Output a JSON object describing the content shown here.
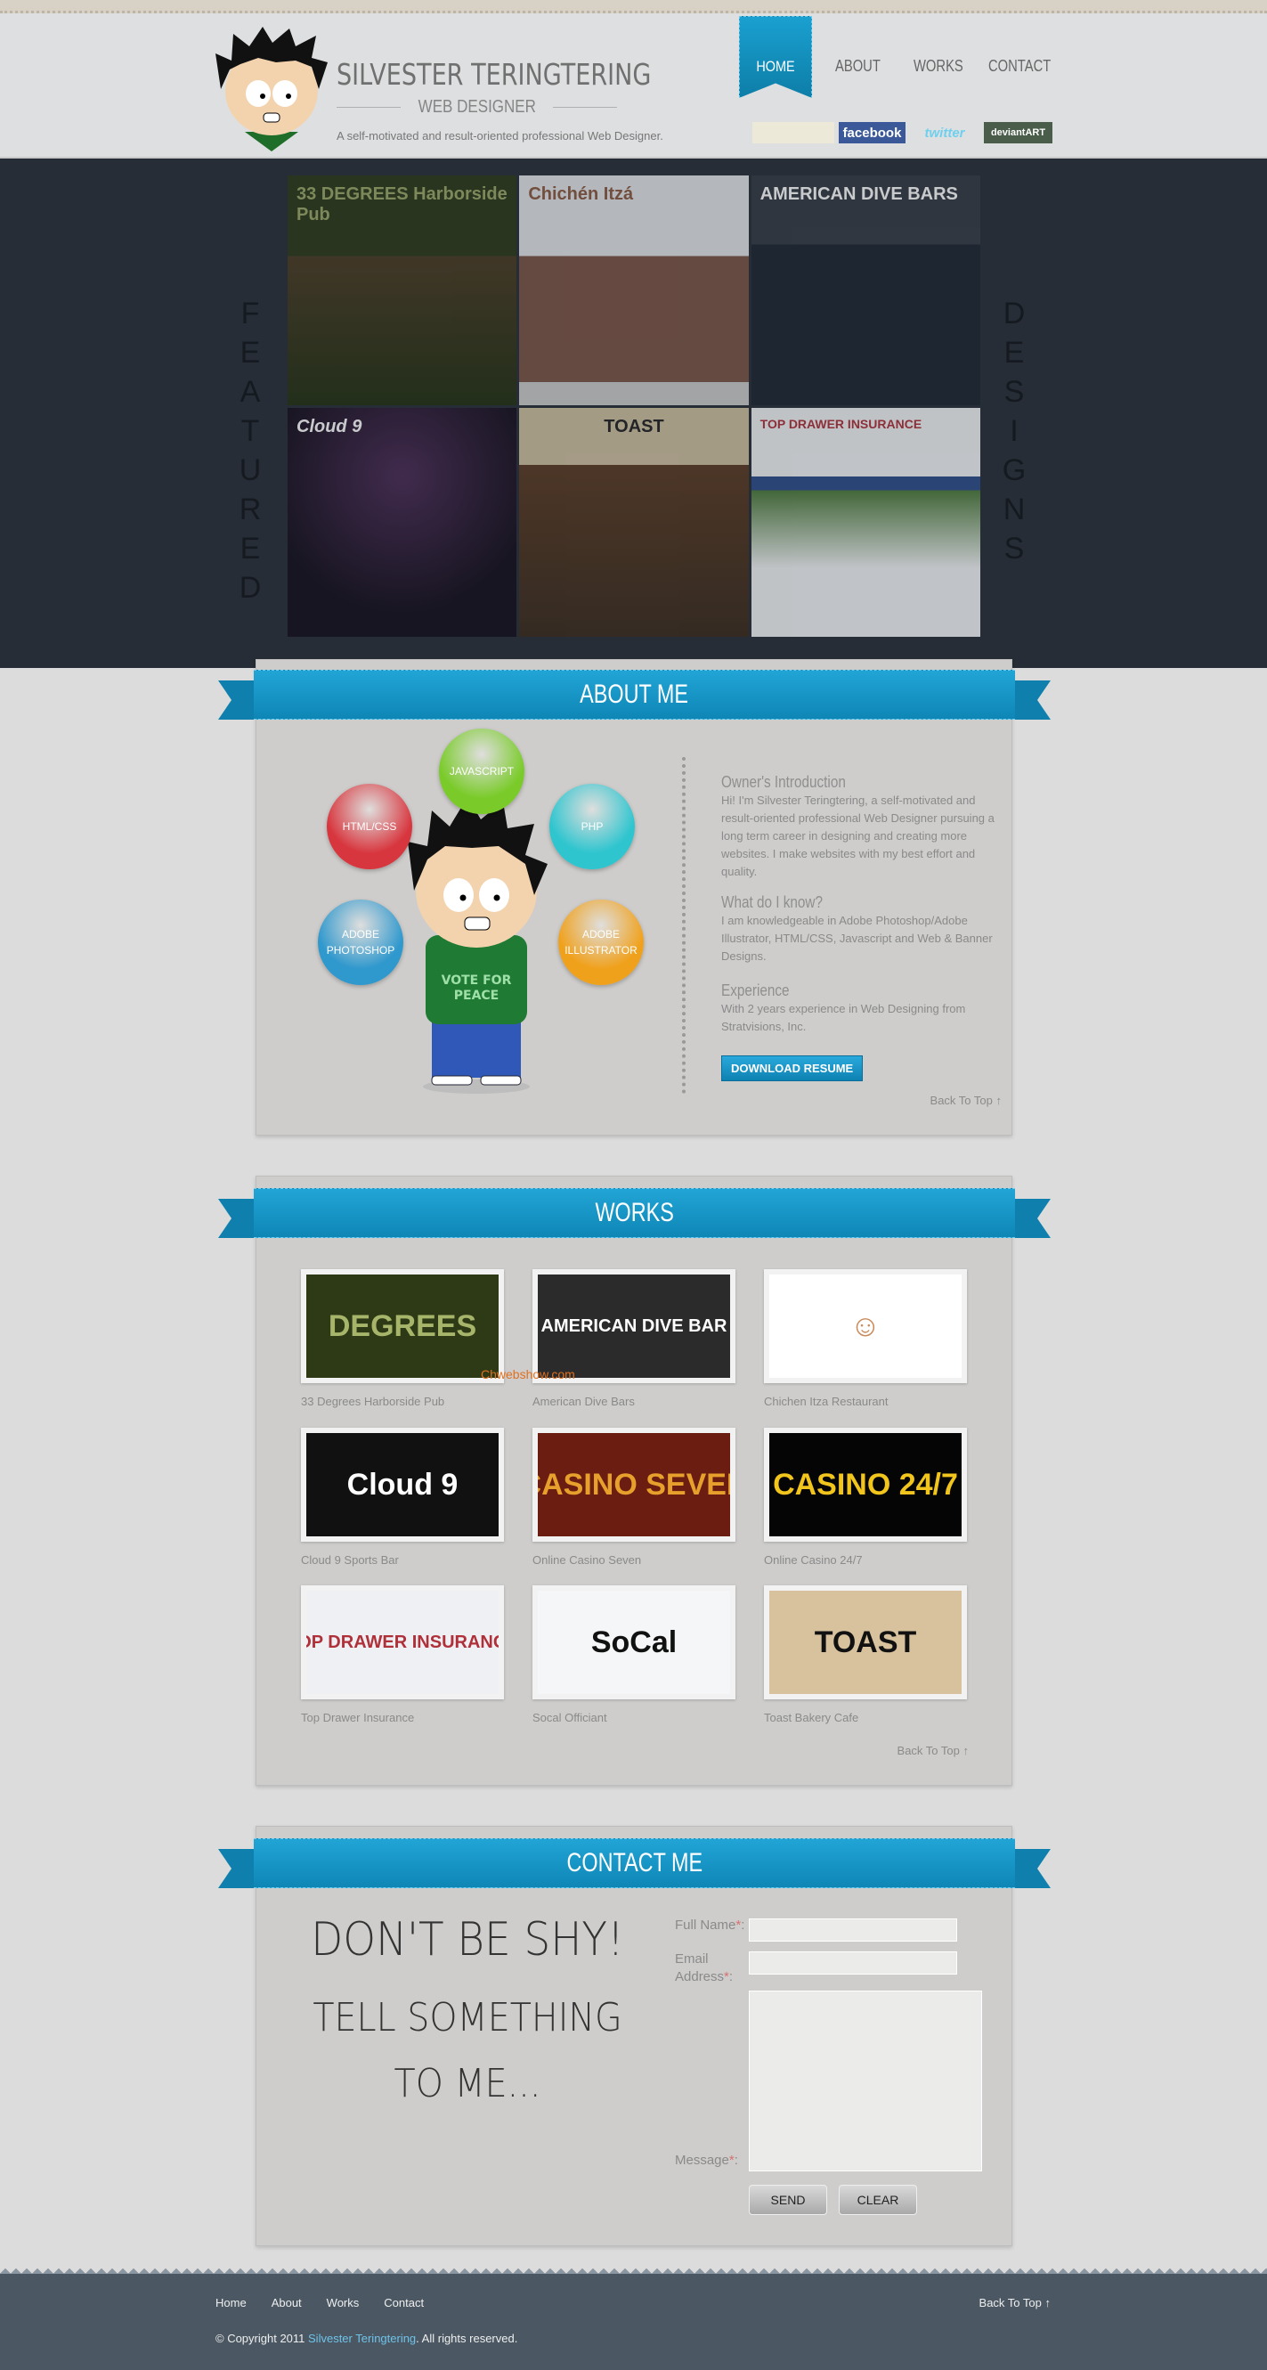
{
  "header": {
    "title": "SILVESTER TERINGTERING",
    "subtitle": "WEB DESIGNER",
    "tagline": "A self-motivated and result-oriented professional Web Designer.",
    "nav": [
      {
        "label": "HOME",
        "active": true
      },
      {
        "label": "ABOUT"
      },
      {
        "label": "WORKS"
      },
      {
        "label": "CONTACT"
      }
    ],
    "social": [
      {
        "label": "facebook",
        "icon": "facebook-icon"
      },
      {
        "label": "twitter",
        "icon": "twitter-icon"
      },
      {
        "label": "deviantART",
        "icon": "deviantart-icon"
      }
    ],
    "search": {
      "value": "",
      "placeholder": ""
    }
  },
  "featured": {
    "left": [
      "F",
      "E",
      "A",
      "T",
      "U",
      "R",
      "E",
      "D"
    ],
    "right": [
      "D",
      "E",
      "S",
      "I",
      "G",
      "N",
      "S"
    ],
    "shots": [
      "33 DEGREES Harborside Pub",
      "Chichén Itzá",
      "AMERICAN DIVE BARS",
      "Cloud 9",
      "TOAST",
      "TOP DRAWER INSURANCE"
    ]
  },
  "about": {
    "title": "ABOUT ME",
    "skills": [
      {
        "label": "JAVASCRIPT",
        "color": "#7acb2a"
      },
      {
        "label": "HTML/CSS",
        "color": "#d8363e"
      },
      {
        "label": "PHP",
        "color": "#2ec5cf"
      },
      {
        "label": "ADOBE PHOTOSHOP",
        "color": "#2f98cd"
      },
      {
        "label": "ADOBE ILLUSTRATOR",
        "color": "#f0a11c"
      }
    ],
    "shirt": "VOTE FOR PEACE",
    "sections": [
      {
        "heading": "Owner's Introduction",
        "text": "Hi! I'm Silvester Teringtering, a self-motivated and result-oriented professional Web Designer pursuing a long term career in designing and creating more websites. I make websites with my best effort and quality."
      },
      {
        "heading": "What do I know?",
        "text": "I am knowledgeable in Adobe Photoshop/Adobe Illustrator, HTML/CSS, Javascript and Web & Banner Designs."
      },
      {
        "heading": "Experience",
        "text": "With 2 years experience in Web Designing from Stratvisions, Inc."
      }
    ],
    "download": "DOWNLOAD RESUME",
    "back": "Back To Top ↑"
  },
  "works": {
    "title": "WORKS",
    "items": [
      {
        "label": "33 Degrees Harborside Pub",
        "thumb": "DEGREES",
        "bg": "#2d3a15",
        "fg": "#a7b56b"
      },
      {
        "label": "American Dive Bars",
        "thumb": "AMERICAN DIVE BAR",
        "bg": "#2b2b2b",
        "fg": "#ffffff"
      },
      {
        "label": "Chichen Itza Restaurant",
        "thumb": "☺",
        "bg": "#ffffff",
        "fg": "#c98a5a"
      },
      {
        "label": "Cloud 9 Sports Bar",
        "thumb": "Cloud 9",
        "bg": "#111111",
        "fg": "#ffffff"
      },
      {
        "label": "Online Casino Seven",
        "thumb": "CASINO SEVEN",
        "bg": "#6a1d10",
        "fg": "#e6a02b"
      },
      {
        "label": "Online Casino 24/7",
        "thumb": "CASINO 24/7",
        "bg": "#050505",
        "fg": "#f2c51c"
      },
      {
        "label": "Top Drawer Insurance",
        "thumb": "TOP DRAWER INSURANCE",
        "bg": "#eef0f4",
        "fg": "#b0303a"
      },
      {
        "label": "Socal Officiant",
        "thumb": "SoCal",
        "bg": "#f4f6f7",
        "fg": "#111111"
      },
      {
        "label": "Toast Bakery Cafe",
        "thumb": "TOAST",
        "bg": "#d8c29e",
        "fg": "#111111"
      }
    ],
    "watermark": "Chwebshow.com",
    "back": "Back To Top ↑"
  },
  "contact": {
    "title": "CONTACT ME",
    "line1": "DON'T BE SHY!",
    "line2": "TELL SOMETHING",
    "line3": "TO ME...",
    "fields": {
      "name": "Full Name",
      "email": "Email Address",
      "message": "Message",
      "required": "*"
    },
    "send": "SEND",
    "clear": "CLEAR"
  },
  "footer": {
    "links": [
      "Home",
      "About",
      "Works",
      "Contact"
    ],
    "back": "Back To Top ↑",
    "copy_pre": "© Copyright 2011 ",
    "copy_name": "Silvester Teringtering",
    "copy_post": ". All rights reserved.",
    "accent": "#6fc2e8"
  }
}
